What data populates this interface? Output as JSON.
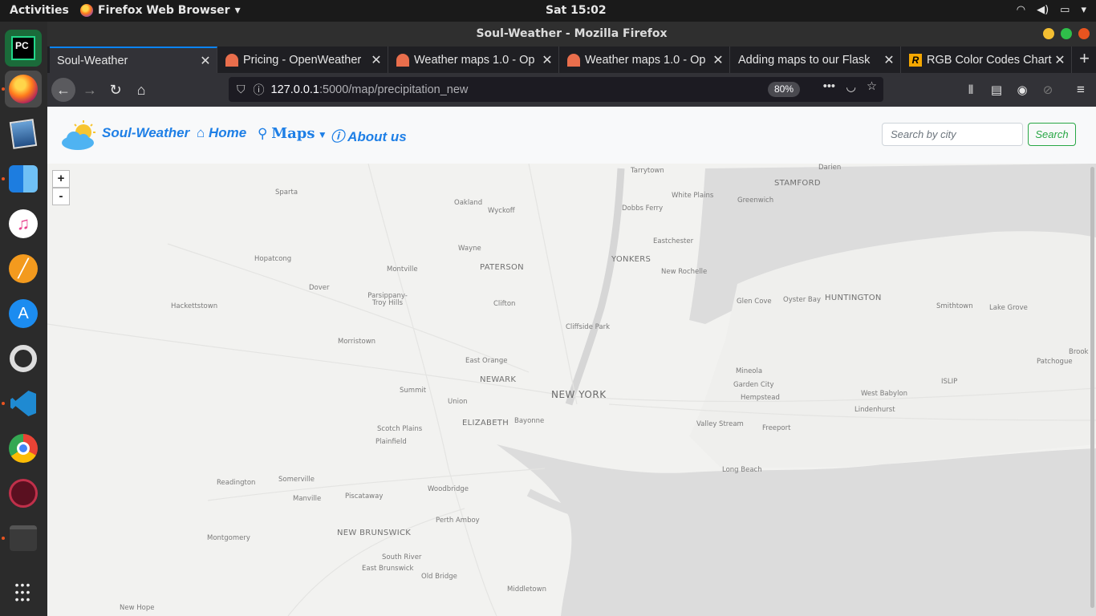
{
  "topbar": {
    "activities": "Activities",
    "app_menu": "Firefox Web Browser",
    "clock": "Sat 15:02"
  },
  "dock": {
    "items": [
      "pycharm",
      "firefox",
      "image-viewer",
      "finder",
      "music",
      "text-editor",
      "app-store",
      "help",
      "vscode",
      "chrome",
      "krita",
      "terminal",
      "app-grid"
    ]
  },
  "window": {
    "title": "Soul-Weather - Mozilla Firefox"
  },
  "tabs": [
    {
      "label": "Soul-Weather",
      "favicon": "none"
    },
    {
      "label": "Pricing - OpenWeather",
      "favicon": "openweather"
    },
    {
      "label": "Weather maps 1.0 - Op",
      "favicon": "openweather"
    },
    {
      "label": "Weather maps 1.0 - Op",
      "favicon": "openweather"
    },
    {
      "label": "Adding maps to our Flask",
      "favicon": "none"
    },
    {
      "label": "RGB Color Codes Chart",
      "favicon": "rapidtables"
    }
  ],
  "urlbar": {
    "host": "127.0.0.1",
    "path": ":5000/map/precipitation_new",
    "zoom": "80%"
  },
  "site": {
    "brand": "Soul-Weather",
    "nav": {
      "home": "Home",
      "maps": "Maps",
      "about": "About us"
    },
    "search_placeholder": "Search by city",
    "search_button": "Search"
  },
  "map": {
    "zoom_in": "+",
    "zoom_out": "-",
    "places": [
      "Tarrytown",
      "Darien",
      "Sparta",
      "Oakland",
      "Wyckoff",
      "White Plains",
      "Greenwich",
      "STAMFORD",
      "Dobbs Ferry",
      "Wayne",
      "Eastchester",
      "Hopatcong",
      "Montville",
      "PATERSON",
      "YONKERS",
      "New Rochelle",
      "Dover",
      "Parsippany-Troy Hills",
      "Clifton",
      "Glen Cove",
      "Oyster Bay",
      "HUNTINGTON",
      "Smithtown",
      "Lake Grove",
      "Hackettstown",
      "Cliffside Park",
      "Morristown",
      "East Orange",
      "Brook",
      "Patchogue",
      "NEWARK",
      "Mineola",
      "Summit",
      "NEW YORK",
      "Garden City",
      "ISLIP",
      "Union",
      "Hempstead",
      "West Babylon",
      "ELIZABETH",
      "Bayonne",
      "Lindenhurst",
      "Scotch Plains",
      "Valley Stream",
      "Freeport",
      "Plainfield",
      "Long Beach",
      "Readington",
      "Somerville",
      "Piscataway",
      "Woodbridge",
      "Manville",
      "Perth Amboy",
      "Montgomery",
      "NEW BRUNSWICK",
      "South River",
      "East Brunswick",
      "Old Bridge",
      "Middletown",
      "New Hope"
    ]
  }
}
